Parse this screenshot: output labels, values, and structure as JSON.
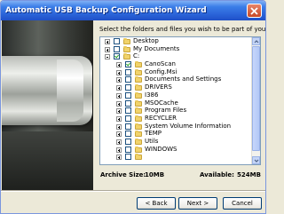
{
  "window": {
    "title": "Automatic USB Backup Configuration Wizard"
  },
  "instruction": "Select the folders and files you wish to be part of your archive.",
  "tree": {
    "items": [
      {
        "label": "Desktop",
        "expander": "+",
        "checked": false
      },
      {
        "label": "My Documents",
        "expander": "+",
        "checked": false
      },
      {
        "label": "C:",
        "expander": "-",
        "checked": true
      },
      {
        "label": "CanoScan",
        "expander": "+",
        "checked": true
      },
      {
        "label": "Config.Msi",
        "expander": "+",
        "checked": false
      },
      {
        "label": "Documents and Settings",
        "expander": "+",
        "checked": false
      },
      {
        "label": "DRIVERS",
        "expander": "+",
        "checked": false
      },
      {
        "label": "I386",
        "expander": "+",
        "checked": false
      },
      {
        "label": "MSOCache",
        "expander": "+",
        "checked": false
      },
      {
        "label": "Program Files",
        "expander": "+",
        "checked": false
      },
      {
        "label": "RECYCLER",
        "expander": "+",
        "checked": false
      },
      {
        "label": "System Volume Information",
        "expander": "+",
        "checked": false
      },
      {
        "label": "TEMP",
        "expander": "+",
        "checked": false
      },
      {
        "label": "Utils",
        "expander": "+",
        "checked": false
      },
      {
        "label": "WINDOWS",
        "expander": "+",
        "checked": false
      },
      {
        "label": "",
        "expander": "+",
        "checked": false
      }
    ]
  },
  "archive_size": {
    "label": "Archive Size:",
    "value": "10MB"
  },
  "available": {
    "label": "Available:",
    "value": "524MB"
  },
  "buttons": {
    "back": "< Back",
    "next": "Next >",
    "cancel": "Cancel"
  }
}
